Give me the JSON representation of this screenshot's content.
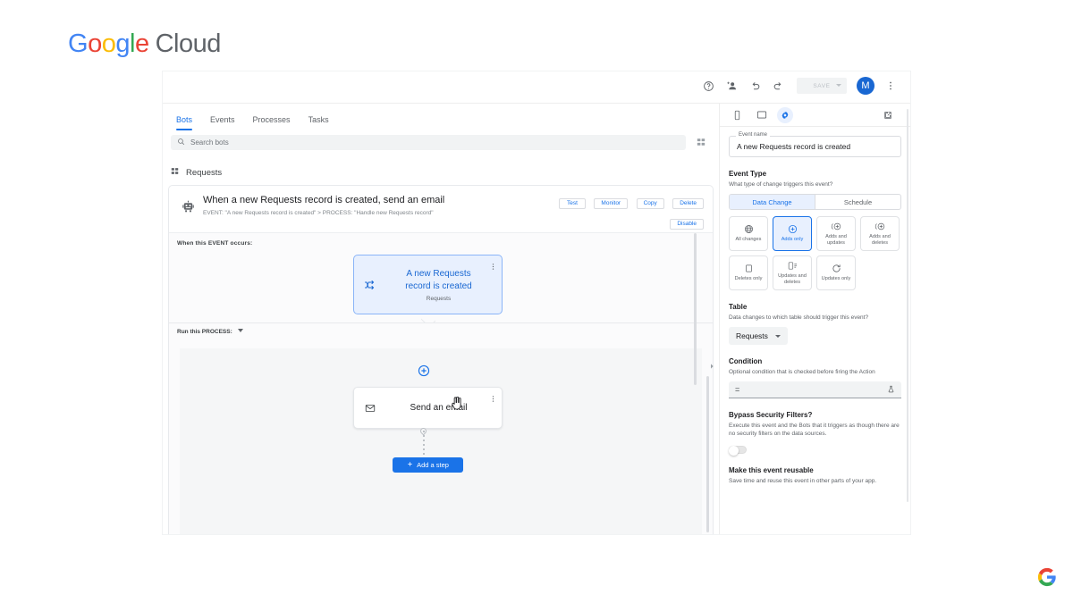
{
  "brand": {
    "wordmark_parts": [
      "G",
      "o",
      "o",
      "g",
      "l",
      "e"
    ],
    "product": "Cloud",
    "colors": {
      "blue": "#4285F4",
      "red": "#EA4335",
      "yellow": "#FBBC05",
      "green": "#34A853",
      "grey": "#5f6368"
    },
    "watermark_icon": "google-g-icon"
  },
  "toolbar": {
    "help_icon": "help-circle-icon",
    "share_icon": "add-person-icon",
    "undo_icon": "undo-icon",
    "redo_icon": "redo-icon",
    "save_label": "SAVE",
    "save_disabled": true,
    "avatar_initial": "M",
    "avatar_color": "#1967d2",
    "more_icon": "more-vert-icon"
  },
  "editor": {
    "tabs": [
      {
        "label": "Bots",
        "active": true
      },
      {
        "label": "Events",
        "active": false
      },
      {
        "label": "Processes",
        "active": false
      },
      {
        "label": "Tasks",
        "active": false
      }
    ],
    "search": {
      "placeholder": "Search bots",
      "value": "",
      "icon": "search-icon"
    },
    "view_toggle_icon": "grid-view-icon",
    "section": {
      "icon": "table-icon",
      "title": "Requests"
    },
    "bot_card": {
      "robot_icon": "robot-icon",
      "title": "When a new Requests record is created, send an email",
      "subtitle": "EVENT: \"A new Requests record is created\" > PROCESS: \"Handle new Requests record\"",
      "actions_row1": [
        "Test",
        "Monitor",
        "Copy",
        "Delete"
      ],
      "actions_row2": [
        "Disable"
      ]
    },
    "canvas": {
      "event_section_label": "When this EVENT occurs:",
      "event_node": {
        "icon": "shuffle-icon",
        "title_line1": "A new Requests",
        "title_line2": "record is created",
        "table": "Requests",
        "menu_icon": "more-vert-icon",
        "selected_border": "#8ab4f8",
        "selected_fill": "#e8f0fe"
      },
      "process_section_label": "Run this PROCESS:",
      "process_caret_icon": "chevron-down-icon",
      "add_node_icon": "plus-circle-icon",
      "step_node": {
        "icon": "email-icon",
        "title": "Send an email",
        "menu_icon": "more-vert-icon"
      },
      "cursor_icon": "pointer-cursor-icon",
      "add_step_label": "Add a step",
      "add_step_icon": "plus-icon",
      "add_step_color": "#1a73e8"
    },
    "collapse_icon": "chevron-right-icon"
  },
  "panel": {
    "header_icons": [
      {
        "name": "mobile-preview-icon",
        "selected": false
      },
      {
        "name": "tablet-preview-icon",
        "selected": false
      },
      {
        "name": "settings-gear-icon",
        "selected": true
      }
    ],
    "open_external_icon": "open-in-new-icon",
    "event_name": {
      "label": "Event name",
      "value": "A new Requests record is created"
    },
    "event_type": {
      "label": "Event Type",
      "help": "What type of change triggers this event?",
      "segments": [
        {
          "label": "Data Change",
          "active": true
        },
        {
          "label": "Schedule",
          "active": false
        }
      ],
      "options": [
        {
          "label": "All changes",
          "icon": "globe-icon",
          "selected": false
        },
        {
          "label": "Adds only",
          "icon": "plus-circle-icon",
          "selected": true
        },
        {
          "label": "Adds and updates",
          "icon": "adds-updates-icon",
          "selected": false
        },
        {
          "label": "Adds and deletes",
          "icon": "adds-deletes-icon",
          "selected": false
        },
        {
          "label": "Deletes only",
          "icon": "delete-square-icon",
          "selected": false
        },
        {
          "label": "Updates and deletes",
          "icon": "updates-deletes-icon",
          "selected": false
        },
        {
          "label": "Updates only",
          "icon": "refresh-icon",
          "selected": false
        }
      ]
    },
    "table": {
      "label": "Table",
      "help": "Data changes to which table should trigger this event?",
      "value": "Requests",
      "caret_icon": "chevron-down-icon"
    },
    "condition": {
      "label": "Condition",
      "help": "Optional condition that is checked before firing the Action",
      "value": "=",
      "test_icon": "flask-icon"
    },
    "bypass": {
      "label": "Bypass Security Filters?",
      "help": "Execute this event and the Bots that it triggers as though there are no security filters on the data sources.",
      "toggle_on": false
    },
    "reusable": {
      "label": "Make this event reusable",
      "help": "Save time and reuse this event in other parts of your app."
    }
  }
}
